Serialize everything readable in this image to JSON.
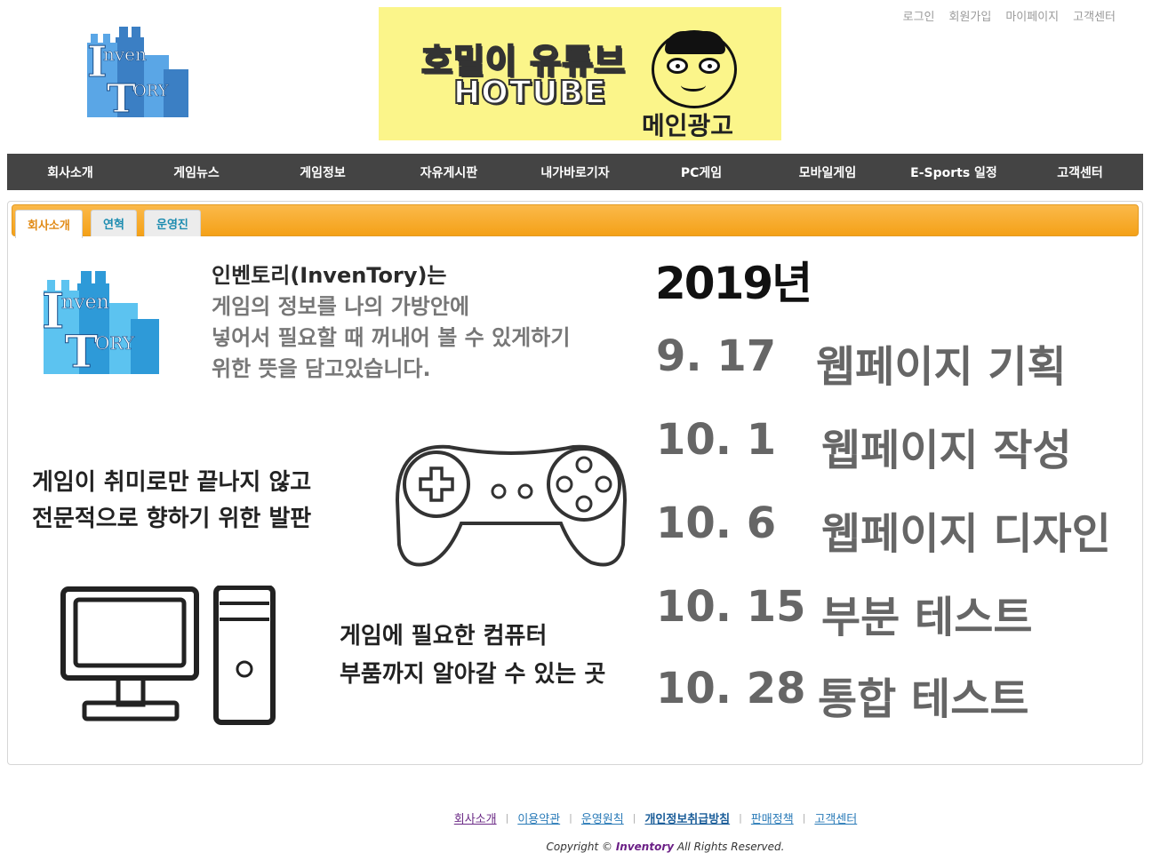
{
  "header": {
    "logo_text": "InvenTory",
    "banner": {
      "line1": "호밀이 유튜브",
      "line2": "HOTUBE",
      "tag": "메인광고"
    },
    "top_links": [
      "로그인",
      "회원가입",
      "마이페이지",
      "고객센터"
    ]
  },
  "nav": [
    "회사소개",
    "게임뉴스",
    "게임정보",
    "자유게시판",
    "내가바로기자",
    "PC게임",
    "모바일게임",
    "E-Sports 일정",
    "고객센터"
  ],
  "tabs": [
    {
      "label": "회사소개",
      "active": true
    },
    {
      "label": "연혁",
      "active": false
    },
    {
      "label": "운영진",
      "active": false
    }
  ],
  "content": {
    "intro": [
      "인벤토리(InvenTory)는",
      "게임의 정보를 나의 가방안에",
      "넣어서 필요할 때 꺼내어 볼 수 있게하기",
      "위한 뜻을 담고있습니다."
    ],
    "hobby": [
      "게임이 취미로만 끝나지 않고",
      "전문적으로 향하기 위한 발판"
    ],
    "parts": [
      "게임에 필요한 컴퓨터",
      "부품까지 알아갈 수 있는 곳"
    ],
    "year": "2019년",
    "schedule": [
      {
        "date": "9. 17",
        "event": "웹페이지 기획"
      },
      {
        "date": "10. 1",
        "event": "웹페이지 작성"
      },
      {
        "date": "10. 6",
        "event": "웹페이지 디자인"
      },
      {
        "date": "10. 15",
        "event": "부분 테스트"
      },
      {
        "date": "10. 28",
        "event": "통합 테스트"
      }
    ]
  },
  "footer": {
    "links": [
      "회사소개",
      "이용약관",
      "운영원칙",
      "개인정보취급방침",
      "판매정책",
      "고객센터"
    ],
    "copyright_prefix": "Copyright ©",
    "copyright_brand": "Inventory",
    "copyright_suffix": "All Rights Reserved."
  },
  "colors": {
    "nav_bg": "#444444",
    "tab_orange": "#f4a118",
    "tab_active_text": "#e18a14",
    "tab_text": "#1d8cb0",
    "banner_bg": "#fbf58a"
  }
}
